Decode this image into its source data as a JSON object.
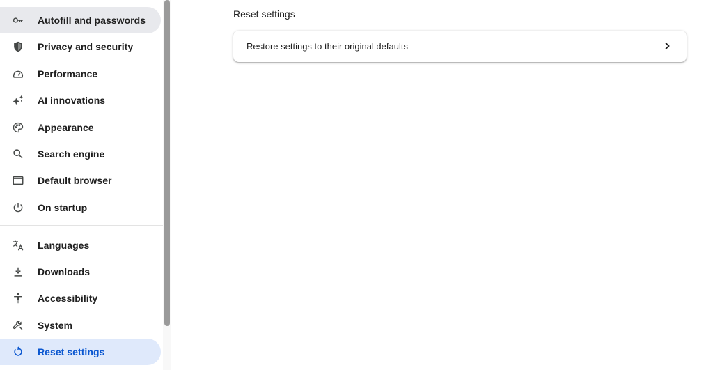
{
  "sidebar": {
    "items": [
      {
        "label": "Autofill and passwords",
        "icon": "key-icon"
      },
      {
        "label": "Privacy and security",
        "icon": "shield-icon"
      },
      {
        "label": "Performance",
        "icon": "speedometer-icon"
      },
      {
        "label": "AI innovations",
        "icon": "sparkle-icon"
      },
      {
        "label": "Appearance",
        "icon": "palette-icon"
      },
      {
        "label": "Search engine",
        "icon": "search-icon"
      },
      {
        "label": "Default browser",
        "icon": "browser-window-icon"
      },
      {
        "label": "On startup",
        "icon": "power-icon"
      },
      {
        "label": "Languages",
        "icon": "translate-icon"
      },
      {
        "label": "Downloads",
        "icon": "download-icon"
      },
      {
        "label": "Accessibility",
        "icon": "accessibility-icon"
      },
      {
        "label": "System",
        "icon": "wrench-icon"
      },
      {
        "label": "Reset settings",
        "icon": "reset-icon"
      }
    ],
    "active": "Reset settings",
    "hovered": "Autofill and passwords"
  },
  "main": {
    "section_title": "Reset settings",
    "restore_row": {
      "label": "Restore settings to their original defaults",
      "icon": "chevron-right-icon"
    }
  },
  "colors": {
    "accent": "#0b57d0",
    "active_bg": "#dfe9fb",
    "hover_bg": "#e8e9ed"
  }
}
